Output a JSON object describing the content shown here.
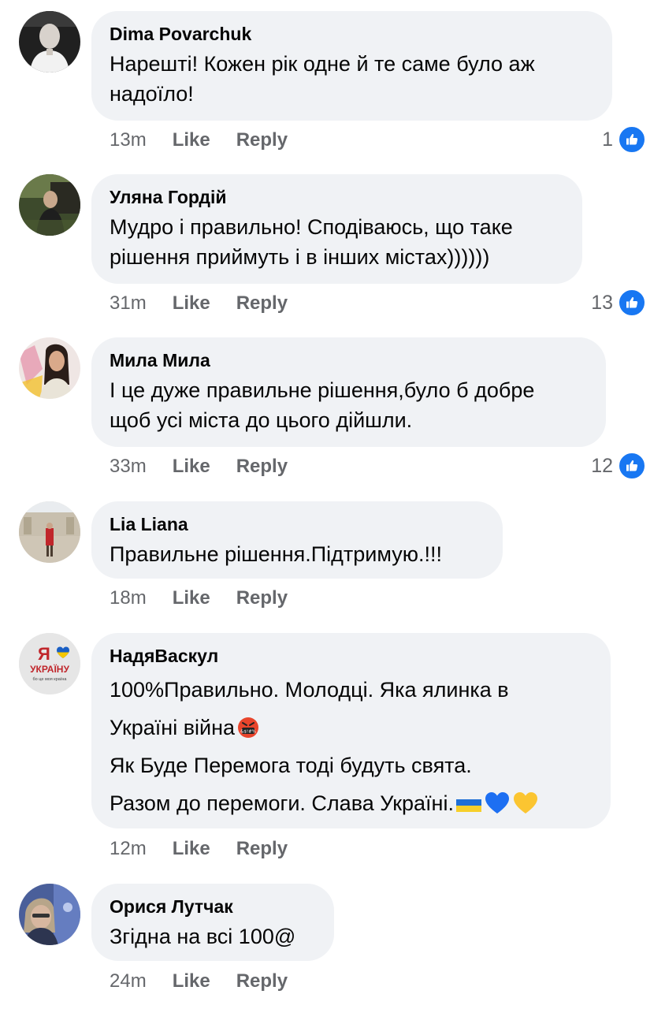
{
  "comments": [
    {
      "author": "Dima Povarchuk",
      "lines": [
        "Нарешті! Кожен рік одне й те саме було аж",
        "надоїло!"
      ],
      "time": "13m",
      "like_label": "Like",
      "reply_label": "Reply",
      "reaction_count": "1"
    },
    {
      "author": "Уляна Гордій",
      "lines": [
        "Мудро і правильно! Сподіваюсь, що таке",
        "рішення приймуть і в інших містах))))))"
      ],
      "time": "31m",
      "like_label": "Like",
      "reply_label": "Reply",
      "reaction_count": "13"
    },
    {
      "author": "Мила Мила",
      "lines": [
        "І це дуже правильне рішення,було б добре",
        "щоб усі міста до цього дійшли."
      ],
      "time": "33m",
      "like_label": "Like",
      "reply_label": "Reply",
      "reaction_count": "12"
    },
    {
      "author": "Lia Liana",
      "lines": [
        "Правильне рішення.Підтримую.!!!"
      ],
      "time": "18m",
      "like_label": "Like",
      "reply_label": "Reply",
      "reaction_count": ""
    },
    {
      "author": "НадяВаскул",
      "lines": [
        "100%Правильно. Молодці. Яка ялинка в",
        "Україні війна",
        "Як Буде Перемога тоді будуть свята.",
        "Разом до перемоги. Слава Україні."
      ],
      "time": "12m",
      "like_label": "Like",
      "reply_label": "Reply",
      "reaction_count": "",
      "avatar_text": {
        "top": "Я",
        "middle": "УКРАЇНУ",
        "bottom": "бо це моя країна"
      }
    },
    {
      "author": "Орися Лутчак",
      "lines": [
        "Згідна на всі 100@"
      ],
      "time": "24m",
      "like_label": "Like",
      "reply_label": "Reply",
      "reaction_count": ""
    }
  ],
  "icons": {
    "like_badge": "thumbs-up-icon",
    "angry_emoji": "cursing-face-emoji",
    "flag_emoji": "ukraine-flag-emoji",
    "blue_heart": "blue-heart-emoji",
    "yellow_heart": "yellow-heart-emoji"
  },
  "colors": {
    "bubble": "#f0f2f5",
    "meta_text": "#65676b",
    "like_blue": "#1877f2"
  }
}
